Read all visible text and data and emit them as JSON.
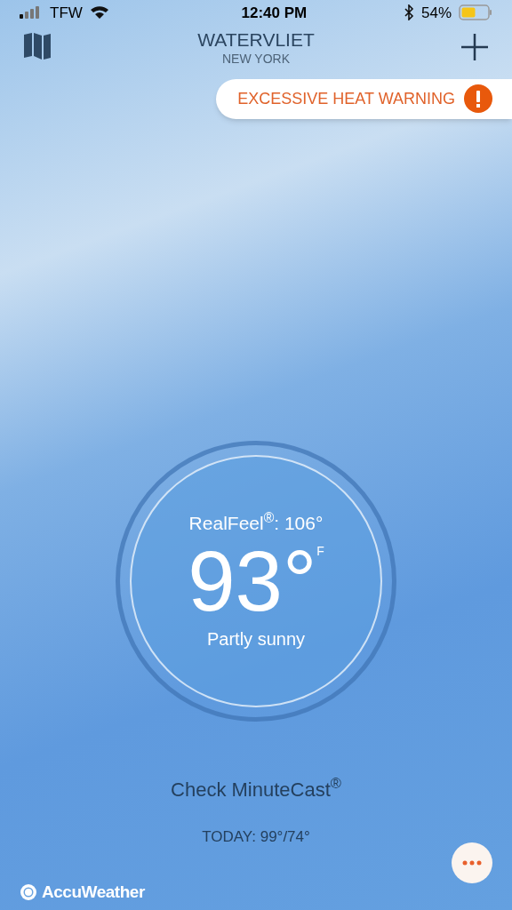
{
  "status_bar": {
    "carrier": "TFW",
    "time": "12:40 PM",
    "battery": "54%"
  },
  "header": {
    "city": "WATERVLIET",
    "region": "NEW YORK"
  },
  "alert": {
    "text": "EXCESSIVE HEAT WARNING"
  },
  "current": {
    "realfeel": "RealFeel$^{®}$: 106°",
    "temperature": "93°",
    "unit": "F",
    "condition": "Partly sunny"
  },
  "minutecast": "Check MinuteCast$^{®}$",
  "today": "TODAY: 99°/74°",
  "brand": "AccuWeather"
}
